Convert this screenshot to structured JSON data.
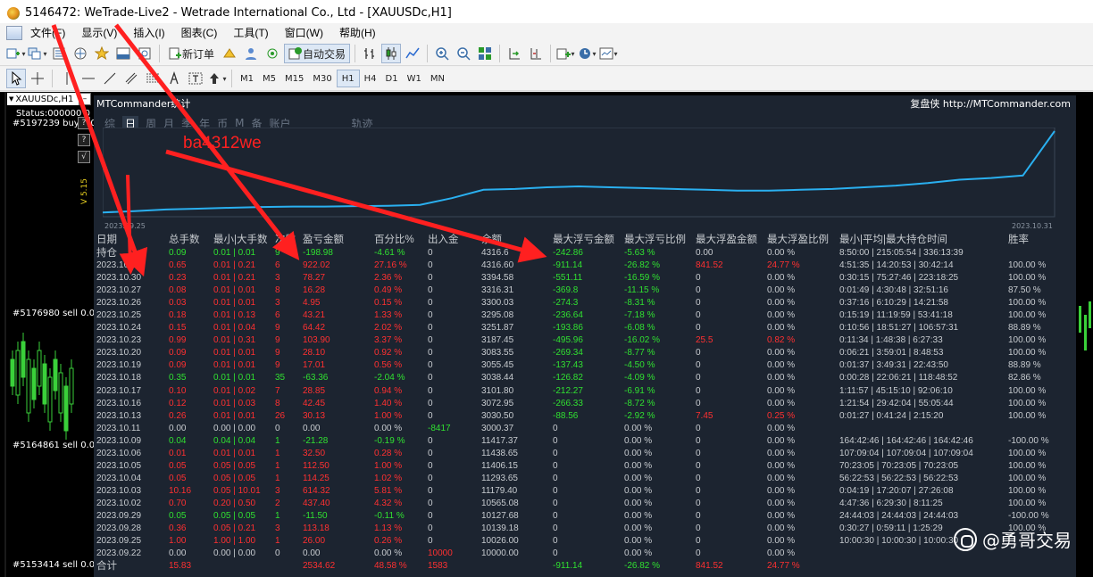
{
  "window": {
    "title": "5146472: WeTrade-Live2 - Wetrade International Co., Ltd - [XAUUSDc,H1]"
  },
  "menu": {
    "items": [
      "文件(F)",
      "显示(V)",
      "插入(I)",
      "图表(C)",
      "工具(T)",
      "窗口(W)",
      "帮助(H)"
    ]
  },
  "toolbar": {
    "new_order": "新订单",
    "auto_trade": "自动交易"
  },
  "timeframes": {
    "items": [
      "M1",
      "M5",
      "M15",
      "M30",
      "H1",
      "H4",
      "D1",
      "W1",
      "MN"
    ],
    "active": "H1"
  },
  "chart": {
    "symbol": "XAUUSDc,H1",
    "status": "Status:000000 0",
    "version": "V 5.15",
    "order_labels": [
      "#5197239 buy 0.0",
      "#5176980 sell 0.01",
      "#5164861 sell 0.01",
      "#5153414 sell 0.01"
    ],
    "side_buttons": [
      "?",
      "?",
      "√"
    ]
  },
  "panel": {
    "title": "MTCommander统计",
    "brand": "复盘侠 http://MTCommander.com",
    "tabs": [
      "综",
      "日",
      "周",
      "月",
      "季",
      "年",
      "币",
      "M",
      "备",
      "账户",
      "轨迹"
    ],
    "active_tab": "日",
    "date_start": "2023.09.25",
    "date_end": "2023.10.31"
  },
  "table": {
    "headers": [
      "日期",
      "总手数",
      "最小|大手数",
      "次数",
      "盈亏金额",
      "百分比%",
      "出入金",
      "余额",
      "最大浮亏金额",
      "最大浮亏比例",
      "最大浮盈金额",
      "最大浮盈比例",
      "最小|平均|最大持仓时间",
      "胜率"
    ],
    "holding": {
      "label": "持仓",
      "lots": "0.09",
      "minmax": "0.01 | 0.01",
      "count": "9",
      "pl": "-198.98",
      "pct": "-4.61 %",
      "deposit": "0",
      "balance": "4316.6",
      "max_loss": "-242.86",
      "max_loss_pct": "-5.63 %",
      "max_profit": "0.00",
      "max_profit_pct": "0.00 %",
      "hold_time": "8:50:00 | 215:05:54 | 336:13:39",
      "win": ""
    },
    "rows": [
      {
        "date": "2023.10.31",
        "lots": "0.65",
        "minmax": "0.01 | 0.21",
        "count": "6",
        "pl": "922.02",
        "pct": "27.16 %",
        "deposit": "0",
        "balance": "4316.60",
        "max_loss": "-911.14",
        "max_loss_pct": "-26.82 %",
        "max_profit": "841.52",
        "max_profit_pct": "24.77 %",
        "hold_time": "4:51:35 | 14:20:53 | 30:42:14",
        "win": "100.00 %"
      },
      {
        "date": "2023.10.30",
        "lots": "0.23",
        "minmax": "0.01 | 0.21",
        "count": "3",
        "pl": "78.27",
        "pct": "2.36 %",
        "deposit": "0",
        "balance": "3394.58",
        "max_loss": "-551.11",
        "max_loss_pct": "-16.59 %",
        "max_profit": "0",
        "max_profit_pct": "0.00 %",
        "hold_time": "0:30:15 | 75:27:46 | 223:18:25",
        "win": "100.00 %"
      },
      {
        "date": "2023.10.27",
        "lots": "0.08",
        "minmax": "0.01 | 0.01",
        "count": "8",
        "pl": "16.28",
        "pct": "0.49 %",
        "deposit": "0",
        "balance": "3316.31",
        "max_loss": "-369.8",
        "max_loss_pct": "-11.15 %",
        "max_profit": "0",
        "max_profit_pct": "0.00 %",
        "hold_time": "0:01:49 | 4:30:48 | 32:51:16",
        "win": "87.50 %"
      },
      {
        "date": "2023.10.26",
        "lots": "0.03",
        "minmax": "0.01 | 0.01",
        "count": "3",
        "pl": "4.95",
        "pct": "0.15 %",
        "deposit": "0",
        "balance": "3300.03",
        "max_loss": "-274.3",
        "max_loss_pct": "-8.31 %",
        "max_profit": "0",
        "max_profit_pct": "0.00 %",
        "hold_time": "0:37:16 | 6:10:29 | 14:21:58",
        "win": "100.00 %"
      },
      {
        "date": "2023.10.25",
        "lots": "0.18",
        "minmax": "0.01 | 0.13",
        "count": "6",
        "pl": "43.21",
        "pct": "1.33 %",
        "deposit": "0",
        "balance": "3295.08",
        "max_loss": "-236.64",
        "max_loss_pct": "-7.18 %",
        "max_profit": "0",
        "max_profit_pct": "0.00 %",
        "hold_time": "0:15:19 | 11:19:59 | 53:41:18",
        "win": "100.00 %"
      },
      {
        "date": "2023.10.24",
        "lots": "0.15",
        "minmax": "0.01 | 0.04",
        "count": "9",
        "pl": "64.42",
        "pct": "2.02 %",
        "deposit": "0",
        "balance": "3251.87",
        "max_loss": "-193.86",
        "max_loss_pct": "-6.08 %",
        "max_profit": "0",
        "max_profit_pct": "0.00 %",
        "hold_time": "0:10:56 | 18:51:27 | 106:57:31",
        "win": "88.89 %"
      },
      {
        "date": "2023.10.23",
        "lots": "0.99",
        "minmax": "0.01 | 0.31",
        "count": "9",
        "pl": "103.90",
        "pct": "3.37 %",
        "deposit": "0",
        "balance": "3187.45",
        "max_loss": "-495.96",
        "max_loss_pct": "-16.02 %",
        "max_profit": "25.5",
        "max_profit_pct": "0.82 %",
        "hold_time": "0:11:34 | 1:48:38 | 6:27:33",
        "win": "100.00 %"
      },
      {
        "date": "2023.10.20",
        "lots": "0.09",
        "minmax": "0.01 | 0.01",
        "count": "9",
        "pl": "28.10",
        "pct": "0.92 %",
        "deposit": "0",
        "balance": "3083.55",
        "max_loss": "-269.34",
        "max_loss_pct": "-8.77 %",
        "max_profit": "0",
        "max_profit_pct": "0.00 %",
        "hold_time": "0:06:21 | 3:59:01 | 8:48:53",
        "win": "100.00 %"
      },
      {
        "date": "2023.10.19",
        "lots": "0.09",
        "minmax": "0.01 | 0.01",
        "count": "9",
        "pl": "17.01",
        "pct": "0.56 %",
        "deposit": "0",
        "balance": "3055.45",
        "max_loss": "-137.43",
        "max_loss_pct": "-4.50 %",
        "max_profit": "0",
        "max_profit_pct": "0.00 %",
        "hold_time": "0:01:37 | 3:49:31 | 22:43:50",
        "win": "88.89 %"
      },
      {
        "date": "2023.10.18",
        "lots": "0.35",
        "minmax": "0.01 | 0.01",
        "count": "35",
        "pl": "-63.36",
        "pct": "-2.04 %",
        "deposit": "0",
        "balance": "3038.44",
        "max_loss": "-126.82",
        "max_loss_pct": "-4.09 %",
        "max_profit": "0",
        "max_profit_pct": "0.00 %",
        "hold_time": "0:00:28 | 22:06:21 | 118:48:52",
        "win": "82.86 %"
      },
      {
        "date": "2023.10.17",
        "lots": "0.10",
        "minmax": "0.01 | 0.02",
        "count": "7",
        "pl": "28.85",
        "pct": "0.94 %",
        "deposit": "0",
        "balance": "3101.80",
        "max_loss": "-212.27",
        "max_loss_pct": "-6.91 %",
        "max_profit": "0",
        "max_profit_pct": "0.00 %",
        "hold_time": "1:11:57 | 45:15:10 | 92:06:10",
        "win": "100.00 %"
      },
      {
        "date": "2023.10.16",
        "lots": "0.12",
        "minmax": "0.01 | 0.03",
        "count": "8",
        "pl": "42.45",
        "pct": "1.40 %",
        "deposit": "0",
        "balance": "3072.95",
        "max_loss": "-266.33",
        "max_loss_pct": "-8.72 %",
        "max_profit": "0",
        "max_profit_pct": "0.00 %",
        "hold_time": "1:21:54 | 29:42:04 | 55:05:44",
        "win": "100.00 %"
      },
      {
        "date": "2023.10.13",
        "lots": "0.26",
        "minmax": "0.01 | 0.01",
        "count": "26",
        "pl": "30.13",
        "pct": "1.00 %",
        "deposit": "0",
        "balance": "3030.50",
        "max_loss": "-88.56",
        "max_loss_pct": "-2.92 %",
        "max_profit": "7.45",
        "max_profit_pct": "0.25 %",
        "hold_time": "0:01:27 | 0:41:24 | 2:15:20",
        "win": "100.00 %"
      },
      {
        "date": "2023.10.11",
        "lots": "0.00",
        "minmax": "0.00 | 0.00",
        "count": "0",
        "pl": "0.00",
        "pct": "0.00 %",
        "deposit": "-8417",
        "balance": "3000.37",
        "max_loss": "0",
        "max_loss_pct": "0.00 %",
        "max_profit": "0",
        "max_profit_pct": "0.00 %",
        "hold_time": "",
        "win": ""
      },
      {
        "date": "2023.10.09",
        "lots": "0.04",
        "minmax": "0.04 | 0.04",
        "count": "1",
        "pl": "-21.28",
        "pct": "-0.19 %",
        "deposit": "0",
        "balance": "11417.37",
        "max_loss": "0",
        "max_loss_pct": "0.00 %",
        "max_profit": "0",
        "max_profit_pct": "0.00 %",
        "hold_time": "164:42:46 | 164:42:46 | 164:42:46",
        "win": "-100.00 %"
      },
      {
        "date": "2023.10.06",
        "lots": "0.01",
        "minmax": "0.01 | 0.01",
        "count": "1",
        "pl": "32.50",
        "pct": "0.28 %",
        "deposit": "0",
        "balance": "11438.65",
        "max_loss": "0",
        "max_loss_pct": "0.00 %",
        "max_profit": "0",
        "max_profit_pct": "0.00 %",
        "hold_time": "107:09:04 | 107:09:04 | 107:09:04",
        "win": "100.00 %"
      },
      {
        "date": "2023.10.05",
        "lots": "0.05",
        "minmax": "0.05 | 0.05",
        "count": "1",
        "pl": "112.50",
        "pct": "1.00 %",
        "deposit": "0",
        "balance": "11406.15",
        "max_loss": "0",
        "max_loss_pct": "0.00 %",
        "max_profit": "0",
        "max_profit_pct": "0.00 %",
        "hold_time": "70:23:05 | 70:23:05 | 70:23:05",
        "win": "100.00 %"
      },
      {
        "date": "2023.10.04",
        "lots": "0.05",
        "minmax": "0.05 | 0.05",
        "count": "1",
        "pl": "114.25",
        "pct": "1.02 %",
        "deposit": "0",
        "balance": "11293.65",
        "max_loss": "0",
        "max_loss_pct": "0.00 %",
        "max_profit": "0",
        "max_profit_pct": "0.00 %",
        "hold_time": "56:22:53 | 56:22:53 | 56:22:53",
        "win": "100.00 %"
      },
      {
        "date": "2023.10.03",
        "lots": "10.16",
        "minmax": "0.05 | 10.01",
        "count": "3",
        "pl": "614.32",
        "pct": "5.81 %",
        "deposit": "0",
        "balance": "11179.40",
        "max_loss": "0",
        "max_loss_pct": "0.00 %",
        "max_profit": "0",
        "max_profit_pct": "0.00 %",
        "hold_time": "0:04:19 | 17:20:07 | 27:26:08",
        "win": "100.00 %"
      },
      {
        "date": "2023.10.02",
        "lots": "0.70",
        "minmax": "0.20 | 0.50",
        "count": "2",
        "pl": "437.40",
        "pct": "4.32 %",
        "deposit": "0",
        "balance": "10565.08",
        "max_loss": "0",
        "max_loss_pct": "0.00 %",
        "max_profit": "0",
        "max_profit_pct": "0.00 %",
        "hold_time": "4:47:36 | 6:29:30 | 8:11:25",
        "win": "100.00 %"
      },
      {
        "date": "2023.09.29",
        "lots": "0.05",
        "minmax": "0.05 | 0.05",
        "count": "1",
        "pl": "-11.50",
        "pct": "-0.11 %",
        "deposit": "0",
        "balance": "10127.68",
        "max_loss": "0",
        "max_loss_pct": "0.00 %",
        "max_profit": "0",
        "max_profit_pct": "0.00 %",
        "hold_time": "24:44:03 | 24:44:03 | 24:44:03",
        "win": "-100.00 %"
      },
      {
        "date": "2023.09.28",
        "lots": "0.36",
        "minmax": "0.05 | 0.21",
        "count": "3",
        "pl": "113.18",
        "pct": "1.13 %",
        "deposit": "0",
        "balance": "10139.18",
        "max_loss": "0",
        "max_loss_pct": "0.00 %",
        "max_profit": "0",
        "max_profit_pct": "0.00 %",
        "hold_time": "0:30:27 | 0:59:11 | 1:25:29",
        "win": "100.00 %"
      },
      {
        "date": "2023.09.25",
        "lots": "1.00",
        "minmax": "1.00 | 1.00",
        "count": "1",
        "pl": "26.00",
        "pct": "0.26 %",
        "deposit": "0",
        "balance": "10026.00",
        "max_loss": "0",
        "max_loss_pct": "0.00 %",
        "max_profit": "0",
        "max_profit_pct": "0.00 %",
        "hold_time": "10:00:30 | 10:00:30 | 10:00:30",
        "win": ""
      },
      {
        "date": "2023.09.22",
        "lots": "0.00",
        "minmax": "0.00 | 0.00",
        "count": "0",
        "pl": "0.00",
        "pct": "0.00 %",
        "deposit": "10000",
        "balance": "10000.00",
        "max_loss": "0",
        "max_loss_pct": "0.00 %",
        "max_profit": "0",
        "max_profit_pct": "0.00 %",
        "hold_time": "",
        "win": ""
      }
    ],
    "total": {
      "label": "合计",
      "lots": "15.83",
      "pl": "2534.62",
      "pct": "48.58 %",
      "deposit": "1583",
      "max_loss": "-911.14",
      "max_loss_pct": "-26.82 %",
      "max_profit": "841.52",
      "max_profit_pct": "24.77 %"
    }
  },
  "annotation": {
    "text": "ba4312we"
  },
  "watermark": {
    "text": "@勇哥交易"
  },
  "equity_curve": [
    0.03,
    0.045,
    0.065,
    0.075,
    0.085,
    0.095,
    0.1,
    0.1,
    0.105,
    0.11,
    0.12,
    0.2,
    0.3,
    0.31,
    0.33,
    0.34,
    0.33,
    0.32,
    0.31,
    0.3,
    0.29,
    0.29,
    0.3,
    0.31,
    0.33,
    0.35,
    0.38,
    0.42,
    0.44,
    0.47,
    1.0
  ]
}
